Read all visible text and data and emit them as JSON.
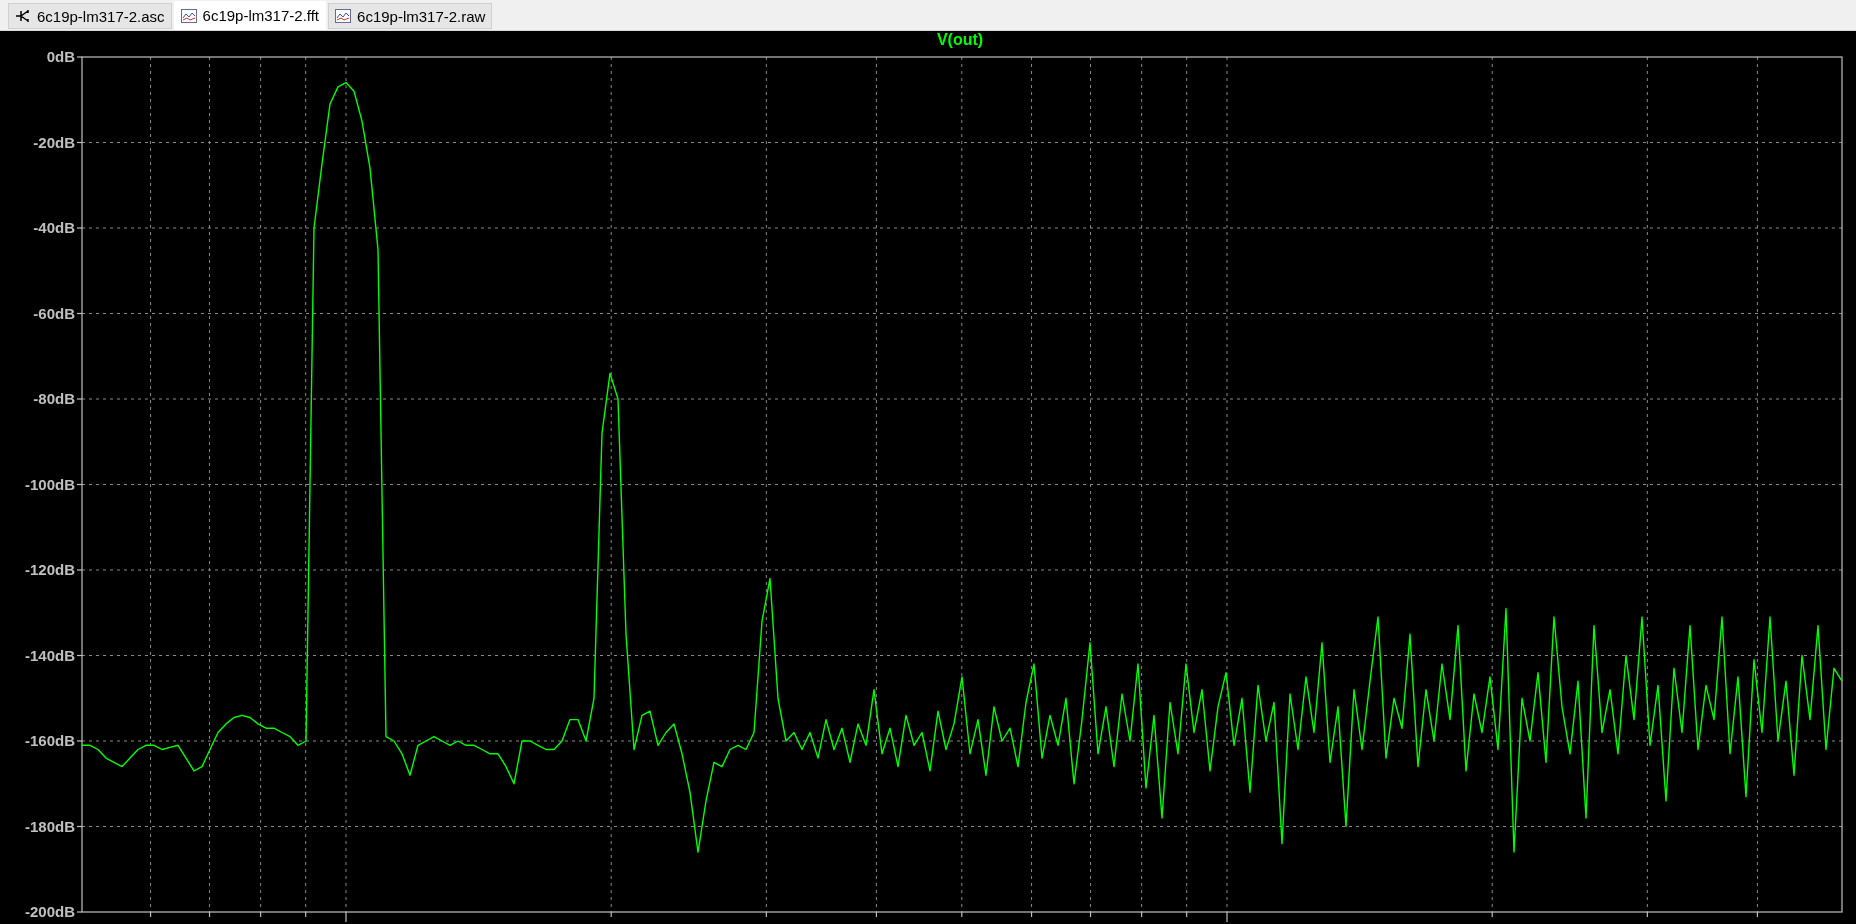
{
  "tabs": [
    {
      "label": "6c19p-lm317-2.asc",
      "kind": "schematic",
      "selected": false
    },
    {
      "label": "6c19p-lm317-2.fft",
      "kind": "waveform",
      "selected": true
    },
    {
      "label": "6c19p-lm317-2.raw",
      "kind": "waveform",
      "selected": false
    }
  ],
  "plot": {
    "chart_data": {
      "type": "line",
      "grid": true,
      "ylim": [
        -200,
        0
      ],
      "yticks": [
        {
          "value": 0,
          "label": "0dB"
        },
        {
          "value": -20,
          "label": "-20dB"
        },
        {
          "value": -40,
          "label": "-40dB"
        },
        {
          "value": -60,
          "label": "-60dB"
        },
        {
          "value": -80,
          "label": "-80dB"
        },
        {
          "value": -100,
          "label": "-100dB"
        },
        {
          "value": -120,
          "label": "-120dB"
        },
        {
          "value": -140,
          "label": "-140dB"
        },
        {
          "value": -160,
          "label": "-160dB"
        },
        {
          "value": -180,
          "label": "-180dB"
        },
        {
          "value": -200,
          "label": "-200dB"
        }
      ],
      "series": [
        {
          "name": "V(out)",
          "color": "#00ff00",
          "values": [
            -161,
            -161,
            -162,
            -164,
            -165,
            -166,
            -164,
            -162,
            -161,
            -161,
            -162,
            -161.5,
            -161,
            -164,
            -167,
            -166,
            -162,
            -158,
            -156,
            -154.5,
            -154,
            -154.5,
            -156,
            -157,
            -157,
            -158,
            -159,
            -161,
            -160,
            -40,
            -25,
            -11,
            -7,
            -6,
            -8,
            -15,
            -26,
            -45,
            -159,
            -160,
            -163,
            -168,
            -161,
            -160,
            -159,
            -160,
            -161,
            -160,
            -161,
            -161,
            -162,
            -163,
            -163,
            -166,
            -170,
            -160,
            -160,
            -161,
            -162,
            -162,
            -160,
            -155,
            -155,
            -160,
            -150,
            -88,
            -74,
            -80,
            -135,
            -162,
            -154,
            -153,
            -161,
            -158,
            -156,
            -163,
            -172,
            -186,
            -174,
            -165,
            -166,
            -162,
            -161,
            -162,
            -158,
            -132,
            -122,
            -150,
            -160,
            -158,
            -162,
            -158,
            -164,
            -155,
            -162,
            -157,
            -165,
            -156,
            -161,
            -148,
            -163,
            -157,
            -166,
            -154,
            -161,
            -158,
            -167,
            -153,
            -162,
            -156,
            -145,
            -163,
            -155,
            -168,
            -152,
            -160,
            -157,
            -166,
            -151,
            -142,
            -164,
            -154,
            -161,
            -150,
            -170,
            -155,
            -137,
            -163,
            -152,
            -166,
            -149,
            -160,
            -142,
            -171,
            -154,
            -178,
            -151,
            -163,
            -142,
            -158,
            -148,
            -167,
            -152,
            -144,
            -161,
            -150,
            -172,
            -147,
            -160,
            -151,
            -184,
            -149,
            -162,
            -145,
            -158,
            -137,
            -165,
            -152,
            -180,
            -148,
            -162,
            -146,
            -131,
            -164,
            -150,
            -157,
            -135,
            -166,
            -148,
            -160,
            -142,
            -155,
            -133,
            -167,
            -149,
            -158,
            -145,
            -162,
            -129,
            -186,
            -150,
            -160,
            -144,
            -165,
            -131,
            -152,
            -163,
            -146,
            -178,
            -133,
            -158,
            -148,
            -163,
            -140,
            -155,
            -131,
            -161,
            -147,
            -174,
            -143,
            -158,
            -133,
            -162,
            -147,
            -155,
            -131,
            -163,
            -145,
            -173,
            -141,
            -158,
            -131,
            -160,
            -146,
            -168,
            -140,
            -155,
            -133,
            -162,
            -143,
            -146
          ]
        }
      ]
    }
  }
}
